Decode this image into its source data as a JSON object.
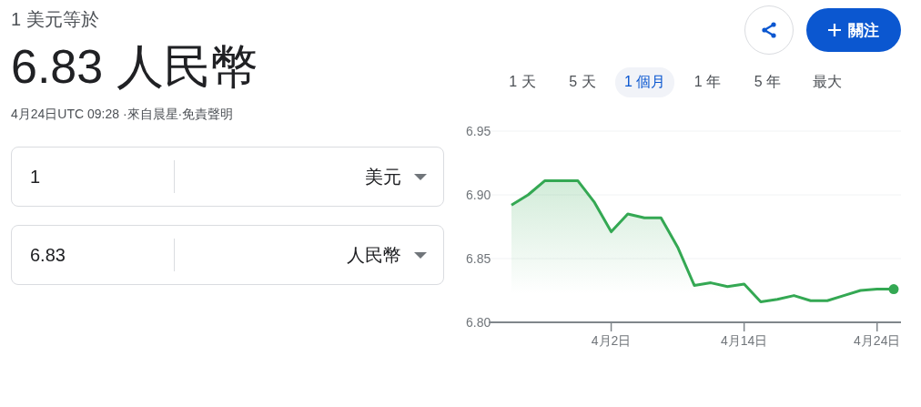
{
  "header": {
    "caption": "1 美元等於",
    "value": "6.83 人民幣",
    "meta": "4月24日UTC 09:28 ·來自晨星·免責聲明"
  },
  "actions": {
    "follow_label": "關注"
  },
  "converter": [
    {
      "amount": "1",
      "currency": "美元"
    },
    {
      "amount": "6.83",
      "currency": "人民幣"
    }
  ],
  "ranges": [
    {
      "label": "1 天",
      "selected": false
    },
    {
      "label": "5 天",
      "selected": false
    },
    {
      "label": "1 個月",
      "selected": true
    },
    {
      "label": "1 年",
      "selected": false
    },
    {
      "label": "5 年",
      "selected": false
    },
    {
      "label": "最大",
      "selected": false
    }
  ],
  "chart_data": {
    "type": "area",
    "categories": [
      null,
      null,
      null,
      null,
      null,
      null,
      "4月2日",
      null,
      null,
      null,
      null,
      null,
      null,
      null,
      "4月14日",
      null,
      null,
      null,
      null,
      null,
      null,
      null,
      "4月24日",
      null
    ],
    "series": [
      {
        "color": "#34a853",
        "values": [
          6.892,
          6.9,
          6.911,
          6.911,
          6.911,
          6.894,
          6.871,
          6.885,
          6.882,
          6.882,
          6.859,
          6.829,
          6.831,
          6.828,
          6.83,
          6.816,
          6.818,
          6.821,
          6.817,
          6.817,
          6.821,
          6.825,
          6.826,
          6.826
        ]
      }
    ],
    "ylim": [
      6.8,
      6.95
    ],
    "yticks": [
      {
        "value": 6.8,
        "label": "6.80"
      },
      {
        "value": 6.85,
        "label": "6.85"
      },
      {
        "value": 6.9,
        "label": "6.90"
      },
      {
        "value": 6.95,
        "label": "6.95"
      }
    ]
  }
}
